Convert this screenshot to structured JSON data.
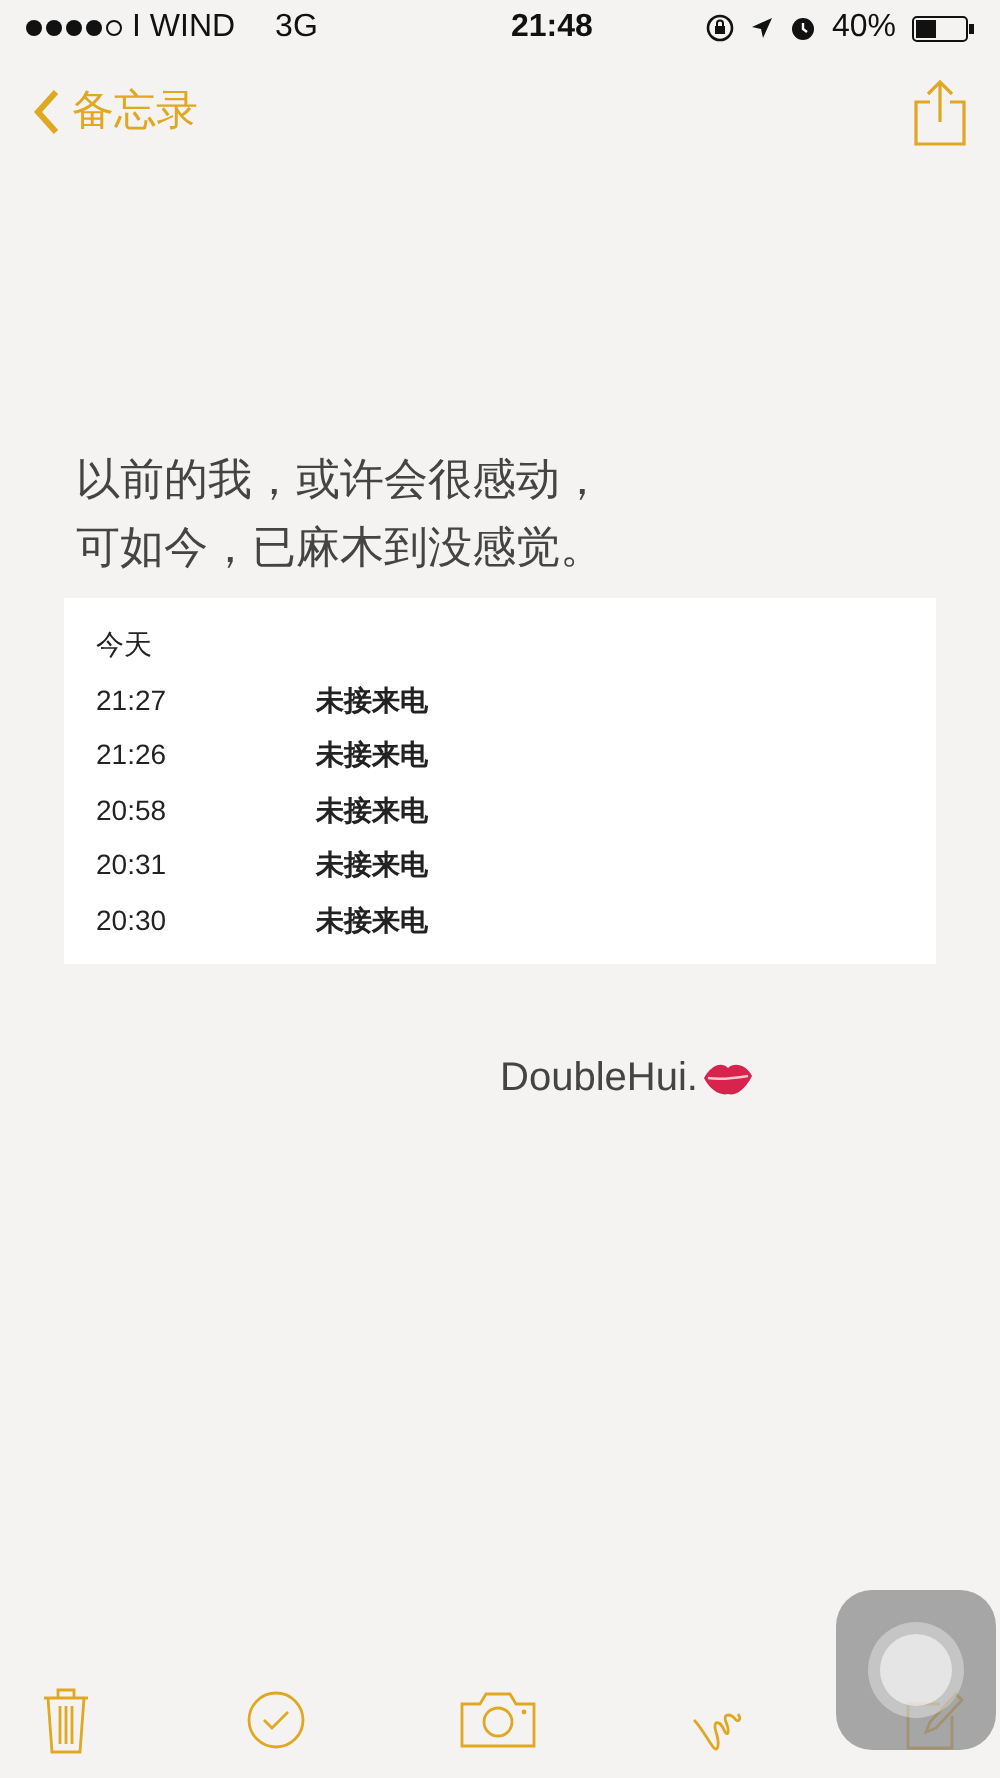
{
  "status_bar": {
    "carrier": "I WIND",
    "network": "3G",
    "time": "21:48",
    "battery": "40%"
  },
  "nav": {
    "back_label": "备忘录"
  },
  "note": {
    "lines": [
      "以前的我，或许会很感动，",
      "可如今，已麻木到没感觉。"
    ],
    "call_log": {
      "heading": "今天",
      "rows": [
        {
          "time": "21:27",
          "event": "未接来电"
        },
        {
          "time": "21:26",
          "event": "未接来电"
        },
        {
          "time": "20:58",
          "event": "未接来电"
        },
        {
          "time": "20:31",
          "event": "未接来电"
        },
        {
          "time": "20:30",
          "event": "未接来电"
        }
      ]
    },
    "signature": "DoubleHui."
  }
}
